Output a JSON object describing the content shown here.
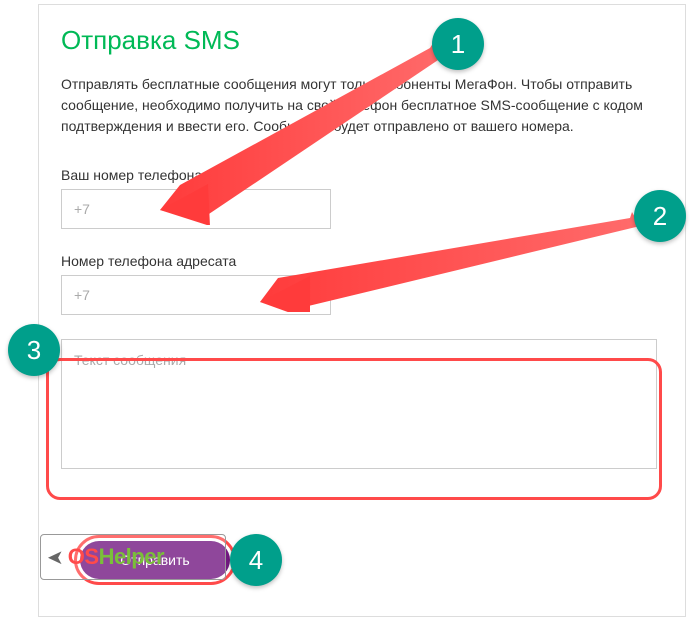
{
  "title": "Отправка SMS",
  "description": "Отправлять бесплатные сообщения могут только абоненты МегаФон. Чтобы отправить сообщение, необходимо получить на свой телефон бесплатное SMS-сообщение с кодом подтверждения и ввести его. Сообщение будет отправлено от вашего номера.",
  "fields": {
    "sender": {
      "label": "Ваш номер телефона",
      "placeholder": "+7",
      "value": ""
    },
    "recipient": {
      "label": "Номер телефона адресата",
      "placeholder": "+7",
      "value": ""
    },
    "message": {
      "placeholder": "Текст сообщения",
      "value": ""
    }
  },
  "submit_label": "Отправить",
  "annotations": {
    "steps": {
      "1": "1",
      "2": "2",
      "3": "3",
      "4": "4"
    }
  },
  "watermark": {
    "part1": "OS",
    "part2": "Helper"
  },
  "colors": {
    "accent_green": "#00b956",
    "badge_teal": "#009f8b",
    "highlight_red": "#ff4a4a",
    "button_purple": "#731982"
  }
}
